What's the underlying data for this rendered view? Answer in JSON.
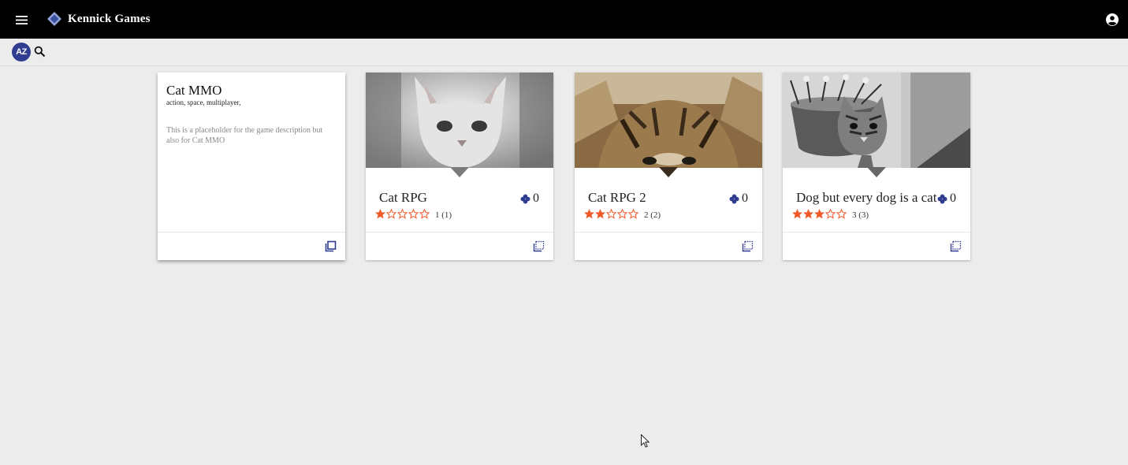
{
  "app": {
    "name": "Kennick Games",
    "brand_color": "#000000",
    "accent_color": "#2f3c8f",
    "star_color": "#f05a28"
  },
  "toolbar": {
    "sort_label": "AZ"
  },
  "cards": [
    {
      "title": "Cat MMO",
      "tags": "action, space, multiplayer,",
      "description": "This is a placeholder for the game description but also for Cat MMO",
      "flipped": true
    },
    {
      "title": "Cat RPG",
      "players": "0",
      "rating": 1,
      "max_rating": 5,
      "rating_text": "1 (1)",
      "image": "white kitten (grayscale)"
    },
    {
      "title": "Cat RPG 2",
      "players": "0",
      "rating": 2,
      "max_rating": 5,
      "rating_text": "2 (2)",
      "image": "tabby kitten close-up"
    },
    {
      "title": "Dog but every dog is a cat",
      "players": "0",
      "rating": 3,
      "max_rating": 5,
      "rating_text": "3 (3)",
      "image": "kitten in flower pot (grayscale)"
    }
  ]
}
